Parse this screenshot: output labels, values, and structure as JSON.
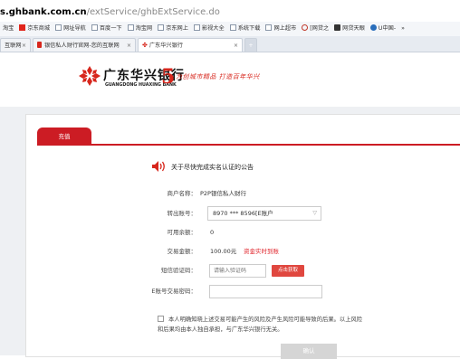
{
  "browser": {
    "url_host": "s.ghbank.com.cn",
    "url_path": "/extService/ghbExtService.do",
    "bookmarks": [
      {
        "label": "淘宝",
        "icon": "none"
      },
      {
        "label": "京东商城",
        "icon": "jd-icon"
      },
      {
        "label": "网址导航",
        "icon": "page-icon"
      },
      {
        "label": "百度一下",
        "icon": "page-icon"
      },
      {
        "label": "淘宝网",
        "icon": "page-icon"
      },
      {
        "label": "京东网上",
        "icon": "page-icon"
      },
      {
        "label": "影视大全",
        "icon": "page-icon"
      },
      {
        "label": "系统下载",
        "icon": "page-icon"
      },
      {
        "label": "网上超市",
        "icon": "page-icon"
      },
      {
        "label": "[网贷之",
        "icon": "circle-icon"
      },
      {
        "label": "网贷天眼",
        "icon": "eye-icon"
      },
      {
        "label": "U中国-",
        "icon": "u-icon"
      },
      {
        "label": "»",
        "icon": "none"
      }
    ],
    "tabs": [
      {
        "label": "互联网",
        "icon": "none"
      },
      {
        "label": "银信私人财行官网-您的互联网",
        "icon": "red-icon"
      },
      {
        "label": "广东华兴银行",
        "icon": "bank-icon"
      },
      {
        "label": "+",
        "icon": "plus-icon"
      }
    ]
  },
  "header": {
    "bank_name": "广东华兴银行",
    "bank_name_en": "GUANGDONG HUAXING BANK",
    "badge_number": "5",
    "slogan": "为创城市精品 打造百年华兴"
  },
  "form": {
    "tab_label": "充值",
    "notice": "关于尽快完成实名认证的公告",
    "merchant_label": "商户名称：",
    "merchant_value": "P2P银信私人财行",
    "account_label": "转出账号：",
    "account_value": "8970 *** 8596[E账户",
    "available_label": "可用余额：",
    "available_value": "0",
    "amount_label": "交易金额：",
    "amount_value": "100.00元",
    "recharge_link": "资金实时到账",
    "sms_label": "短信验证码：",
    "sms_placeholder": "请输入验证码",
    "get_code_button": "点击获取",
    "password_label": "E账号交易密码：",
    "agree_line1": "本人明确知晓上述交易可能产生的风险及产生风险可能导致的后果。以上风险",
    "agree_line2": "和后果均由本人独自承担，与广东华兴银行无关。",
    "confirm_button": "确认"
  },
  "colors": {
    "brand_red": "#cc1c24",
    "button_red": "#e0473f",
    "disabled_gray": "#d5d5d5"
  }
}
